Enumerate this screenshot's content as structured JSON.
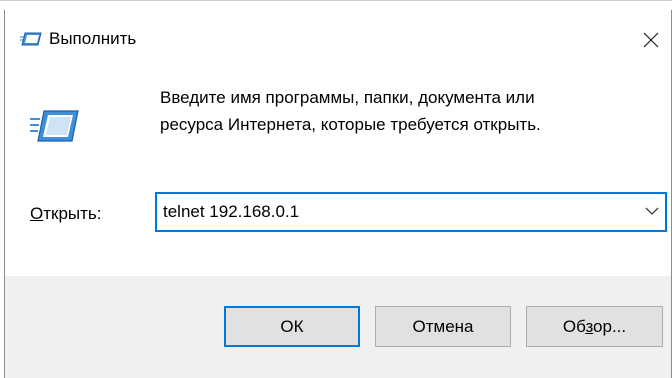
{
  "window": {
    "title": "Выполнить"
  },
  "description": {
    "line1": "Введите имя программы, папки, документа или",
    "line2": "ресурса Интернета, которые требуется открыть."
  },
  "open": {
    "label_mnemonic": "О",
    "label_rest": "ткрыть:",
    "value": "telnet 192.168.0.1"
  },
  "buttons": {
    "ok": "ОК",
    "cancel": "Отмена",
    "browse_pre": "Об",
    "browse_mnemonic": "з",
    "browse_post": "ор..."
  },
  "icons": {
    "title": "run-icon",
    "main": "run-icon",
    "close": "close-icon",
    "dropdown": "chevron-down-icon"
  },
  "colors": {
    "accent": "#0078d7",
    "icon_blue": "#3c8fd8",
    "footer_bg": "#f0f0f0",
    "button_bg": "#e1e1e1"
  }
}
